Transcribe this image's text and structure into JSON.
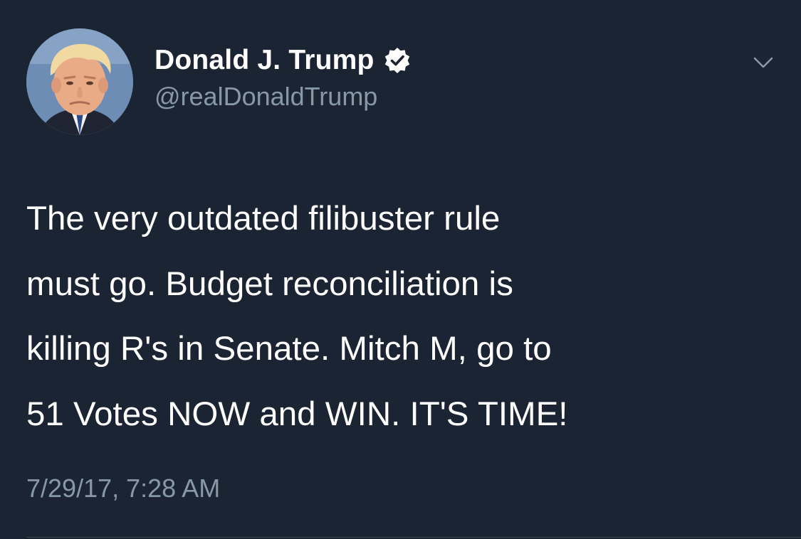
{
  "author": {
    "display_name": "Donald J. Trump",
    "handle": "@realDonaldTrump",
    "verified": true
  },
  "icons": {
    "avatar": "profile-photo",
    "verified": "verified-badge-icon",
    "menu": "chevron-down-icon"
  },
  "tweet": {
    "lines": [
      "The very outdated filibuster rule",
      "must go. Budget reconciliation is",
      "killing R's in Senate. Mitch M, go to",
      "51 Votes NOW and WIN. IT'S TIME!"
    ],
    "timestamp": "7/29/17, 7:28 AM"
  },
  "colors": {
    "background": "#1b2432",
    "text_primary": "#ffffff",
    "text_secondary": "#8899a6"
  }
}
